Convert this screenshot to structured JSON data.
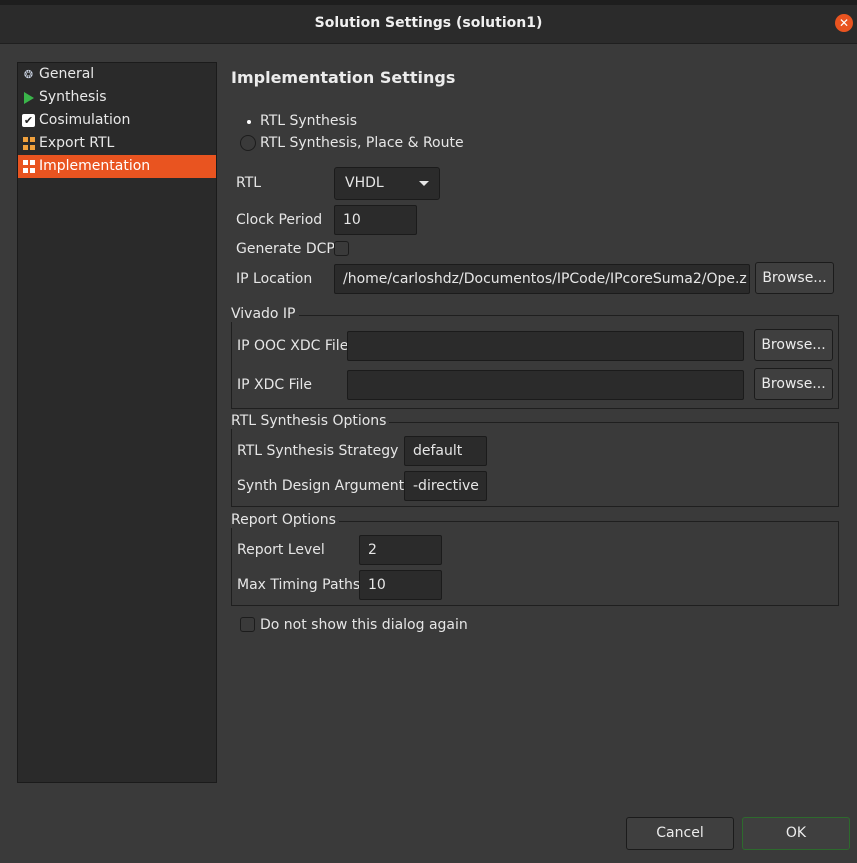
{
  "window": {
    "title": "Solution Settings (solution1)"
  },
  "nav": {
    "items": [
      {
        "label": "General",
        "icon": "gear-icon"
      },
      {
        "label": "Synthesis",
        "icon": "play-icon"
      },
      {
        "label": "Cosimulation",
        "icon": "checkbox-icon"
      },
      {
        "label": "Export RTL",
        "icon": "grid-icon"
      },
      {
        "label": "Implementation",
        "icon": "grid-icon",
        "selected": true
      }
    ]
  },
  "main": {
    "title": "Implementation Settings",
    "mode": {
      "options": [
        "RTL Synthesis",
        "RTL Synthesis, Place & Route"
      ],
      "selected": "RTL Synthesis"
    },
    "rtl": {
      "label": "RTL",
      "value": "VHDL"
    },
    "clock_period": {
      "label": "Clock Period",
      "value": "10"
    },
    "generate_dcp": {
      "label": "Generate DCP",
      "checked": false
    },
    "ip_location": {
      "label": "IP Location",
      "value": "/home/carloshdz/Documentos/IPCode/IPcoreSuma2/Ope.z",
      "browse": "Browse..."
    },
    "vivado_ip": {
      "title": "Vivado IP",
      "ooc_xdc": {
        "label": "IP OOC XDC File",
        "value": "",
        "browse": "Browse..."
      },
      "xdc": {
        "label": "IP XDC File",
        "value": "",
        "browse": "Browse..."
      }
    },
    "rtl_synth_options": {
      "title": "RTL Synthesis Options",
      "strategy": {
        "label": "RTL Synthesis Strategy",
        "value": "default"
      },
      "args": {
        "label": "Synth Design Arguments",
        "value": "-directive"
      }
    },
    "report_options": {
      "title": "Report Options",
      "level": {
        "label": "Report Level",
        "value": "2"
      },
      "max_paths": {
        "label": "Max Timing Paths",
        "value": "10"
      }
    },
    "dont_show": {
      "label": "Do not show this dialog again",
      "checked": false
    }
  },
  "footer": {
    "cancel": "Cancel",
    "ok": "OK"
  },
  "colors": {
    "accent": "#e95420",
    "background": "#3a3a3a",
    "ok_border": "#2d6a2d"
  }
}
